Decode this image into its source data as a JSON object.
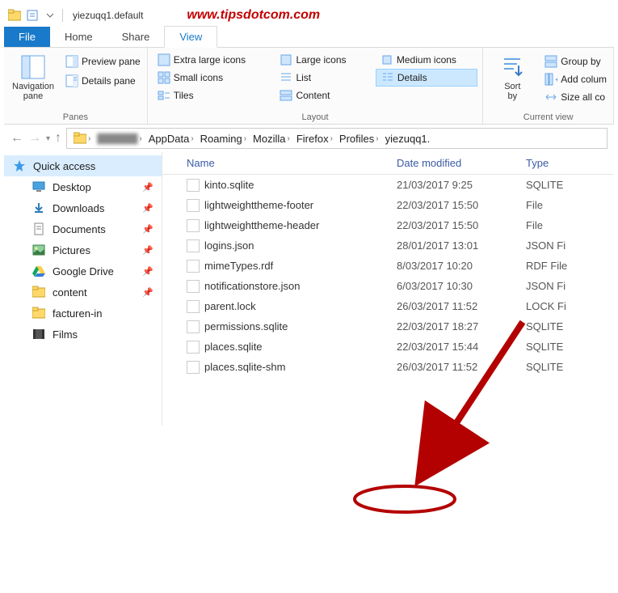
{
  "titlebar": {
    "title": "yiezuqq1.default"
  },
  "watermark": "www.tipsdotcom.com",
  "tabs": {
    "file": "File",
    "home": "Home",
    "share": "Share",
    "view": "View"
  },
  "ribbon": {
    "panes": {
      "nav_pane": "Navigation\npane",
      "preview": "Preview pane",
      "details_pane": "Details pane",
      "group_label": "Panes"
    },
    "layout": {
      "extra_large": "Extra large icons",
      "large": "Large icons",
      "medium": "Medium icons",
      "small": "Small icons",
      "list": "List",
      "details": "Details",
      "tiles": "Tiles",
      "content": "Content",
      "group_label": "Layout"
    },
    "view": {
      "sort_by": "Sort\nby",
      "group_by": "Group by",
      "add_columns": "Add colum",
      "size_all": "Size all co",
      "group_label": "Current view"
    }
  },
  "breadcrumb": [
    "",
    "AppData",
    "Roaming",
    "Mozilla",
    "Firefox",
    "Profiles",
    "yiezuqq1."
  ],
  "sidebar": {
    "quick": "Quick access",
    "items": [
      {
        "label": "Desktop",
        "pin": true
      },
      {
        "label": "Downloads",
        "pin": true
      },
      {
        "label": "Documents",
        "pin": true
      },
      {
        "label": "Pictures",
        "pin": true
      },
      {
        "label": "Google Drive",
        "pin": true
      },
      {
        "label": "content",
        "pin": true
      },
      {
        "label": "facturen-in",
        "pin": false
      },
      {
        "label": "Films",
        "pin": false
      }
    ]
  },
  "columns": {
    "name": "Name",
    "date": "Date modified",
    "type": "Type"
  },
  "files": [
    {
      "name": "kinto.sqlite",
      "date": "21/03/2017 9:25",
      "type": "SQLITE"
    },
    {
      "name": "lightweighttheme-footer",
      "date": "22/03/2017 15:50",
      "type": "File"
    },
    {
      "name": "lightweighttheme-header",
      "date": "22/03/2017 15:50",
      "type": "File"
    },
    {
      "name": "logins.json",
      "date": "28/01/2017 13:01",
      "type": "JSON Fi"
    },
    {
      "name": "mimeTypes.rdf",
      "date": "8/03/2017 10:20",
      "type": "RDF File"
    },
    {
      "name": "notificationstore.json",
      "date": "6/03/2017 10:30",
      "type": "JSON Fi"
    },
    {
      "name": "parent.lock",
      "date": "26/03/2017 11:52",
      "type": "LOCK Fi"
    },
    {
      "name": "permissions.sqlite",
      "date": "22/03/2017 18:27",
      "type": "SQLITE"
    },
    {
      "name": "places.sqlite",
      "date": "22/03/2017 15:44",
      "type": "SQLITE"
    },
    {
      "name": "places.sqlite-shm",
      "date": "26/03/2017 11:52",
      "type": "SQLITE"
    }
  ]
}
